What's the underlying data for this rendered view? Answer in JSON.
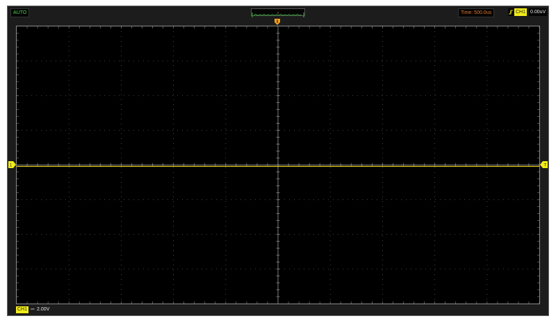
{
  "status_bar": {
    "mode": "AUTO",
    "time_base": "Time: 500.0us",
    "trigger_channel": "CH1",
    "trigger_level": "0.00uV"
  },
  "channel_info": {
    "channel": "CH1",
    "coupling_symbol": "⎓",
    "volts_per_div": "2.00V"
  },
  "grid": {
    "horizontal_divisions": 10,
    "vertical_divisions": 8
  },
  "trace": {
    "channel": "CH1",
    "level_divisions": 0.0
  },
  "colors": {
    "background": "#1c1c1c",
    "screen": "#000000",
    "trace": "#e6d21e",
    "channel_badge": "#f2ec1a",
    "mode_text": "#4cd54c",
    "time_text": "#e2782a",
    "trigger_marker": "#f0a020"
  }
}
